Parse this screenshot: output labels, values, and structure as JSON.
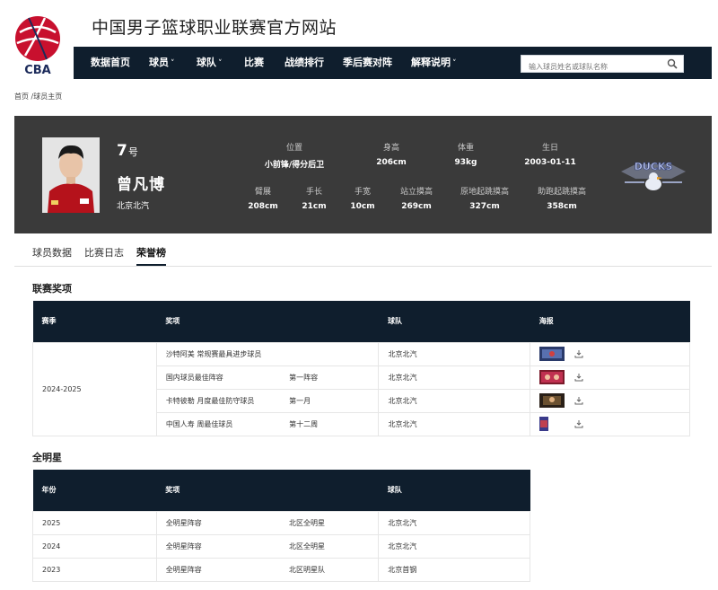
{
  "site": {
    "logo_text": "CBA",
    "title": "中国男子篮球职业联赛官方网站"
  },
  "nav": {
    "items": [
      {
        "label": "数据首页",
        "dropdown": false
      },
      {
        "label": "球员",
        "dropdown": true
      },
      {
        "label": "球队",
        "dropdown": true
      },
      {
        "label": "比赛",
        "dropdown": false
      },
      {
        "label": "战绩排行",
        "dropdown": false
      },
      {
        "label": "季后赛对阵",
        "dropdown": false
      },
      {
        "label": "解释说明",
        "dropdown": true
      }
    ],
    "chevron": "˅",
    "search_placeholder": "输入球员姓名或球队名称"
  },
  "breadcrumb": "首页 /球员主页",
  "player": {
    "number": "7",
    "number_suffix": "号",
    "name": "曾凡博",
    "team": "北京北汽",
    "stats_row1": [
      {
        "label": "位置",
        "value": "小前锋/得分后卫"
      },
      {
        "label": "身高",
        "value": "206cm"
      },
      {
        "label": "体重",
        "value": "93kg"
      },
      {
        "label": "生日",
        "value": "2003-01-11"
      }
    ],
    "stats_row2": [
      {
        "label": "臂展",
        "value": "208cm"
      },
      {
        "label": "手长",
        "value": "21cm"
      },
      {
        "label": "手宽",
        "value": "10cm"
      },
      {
        "label": "站立摸高",
        "value": "269cm"
      },
      {
        "label": "原地起跳摸高",
        "value": "327cm"
      },
      {
        "label": "助跑起跳摸高",
        "value": "358cm"
      }
    ],
    "team_logo_text": "DUCKS"
  },
  "tabs": [
    {
      "label": "球员数据",
      "active": false
    },
    {
      "label": "比赛日志",
      "active": false
    },
    {
      "label": "荣誉榜",
      "active": true
    }
  ],
  "league_awards": {
    "title": "联赛奖项",
    "headers": [
      "赛季",
      "奖项",
      "球队",
      "海报"
    ],
    "season": "2024-2025",
    "rows": [
      {
        "award": "沙特阿美 常规赛最具进步球员",
        "detail": "",
        "team": "北京北汽",
        "poster": "wide"
      },
      {
        "award": "国内球员最佳阵容",
        "detail": "第一阵容",
        "team": "北京北汽",
        "poster": "wide"
      },
      {
        "award": "卡特彼勒 月度最佳防守球员",
        "detail": "第一月",
        "team": "北京北汽",
        "poster": "wide"
      },
      {
        "award": "中国人寿 周最佳球员",
        "detail": "第十二周",
        "team": "北京北汽",
        "poster": "small"
      }
    ]
  },
  "all_star": {
    "title": "全明星",
    "headers": [
      "年份",
      "奖项",
      "球队"
    ],
    "rows": [
      {
        "year": "2025",
        "award": "全明星阵容",
        "detail": "北区全明星",
        "team": "北京北汽"
      },
      {
        "year": "2024",
        "award": "全明星阵容",
        "detail": "北区全明星",
        "team": "北京北汽"
      },
      {
        "year": "2023",
        "award": "全明星阵容",
        "detail": "北区明星队",
        "team": "北京首钢"
      }
    ]
  },
  "colors": {
    "nav_bg": "#0f1e2d",
    "card_bg": "#3a3a3a",
    "logo_red": "#c8102e"
  }
}
